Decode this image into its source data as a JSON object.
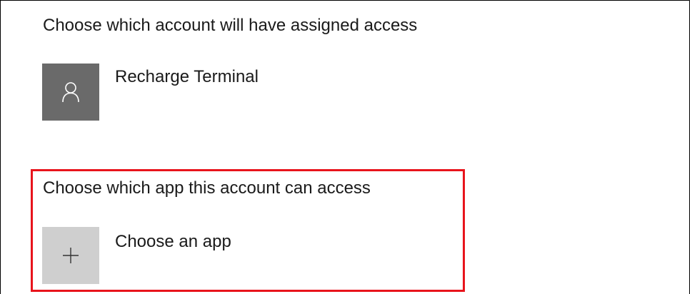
{
  "assigned_account": {
    "heading": "Choose which account will have assigned access",
    "account_name": "Recharge Terminal",
    "icon": "person-icon"
  },
  "assigned_app": {
    "heading": "Choose which app this account can access",
    "choose_label": "Choose an app",
    "icon": "plus-icon"
  },
  "colors": {
    "highlight": "#e8141c",
    "account_tile": "#6a6a6a",
    "app_tile": "#cfcfcf"
  }
}
